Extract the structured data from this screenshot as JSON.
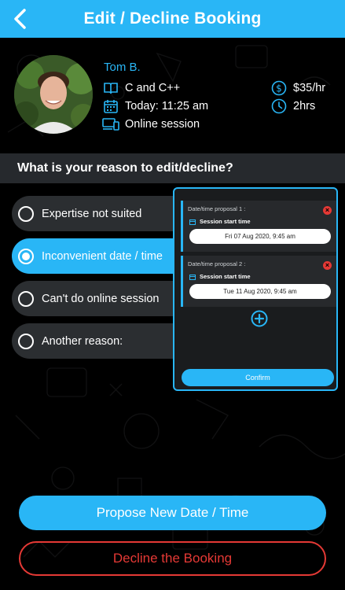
{
  "header": {
    "title": "Edit / Decline Booking"
  },
  "profile": {
    "name": "Tom B.",
    "subject": "C and C++",
    "time": "Today: 11:25 am",
    "mode": "Online session",
    "rate": "$35/hr",
    "duration": "2hrs"
  },
  "reason": {
    "question": "What is your reason to edit/decline?",
    "options": [
      {
        "label": "Expertise not suited",
        "selected": false
      },
      {
        "label": "Inconvenient date / time",
        "selected": true
      },
      {
        "label": "Can't do online session",
        "selected": false
      },
      {
        "label": "Another reason:",
        "selected": false
      }
    ]
  },
  "proposals": [
    {
      "title": "Date/time proposal 1 :",
      "label": "Session start time",
      "value": "Fri 07 Aug 2020, 9:45 am"
    },
    {
      "title": "Date/time proposal 2 :",
      "label": "Session start time",
      "value": "Tue 11 Aug 2020, 9:45 am"
    }
  ],
  "panel": {
    "confirm_label": "Confirm"
  },
  "actions": {
    "propose_label": "Propose New Date / Time",
    "decline_label": "Decline the Booking"
  },
  "colors": {
    "accent": "#29b6f6",
    "danger": "#e53935",
    "background": "#000000",
    "bar": "#26292d"
  },
  "icons": [
    "back-arrow-icon",
    "book-icon",
    "calendar-icon",
    "devices-icon",
    "dollar-icon",
    "clock-icon",
    "close-icon",
    "add-circle-icon"
  ]
}
